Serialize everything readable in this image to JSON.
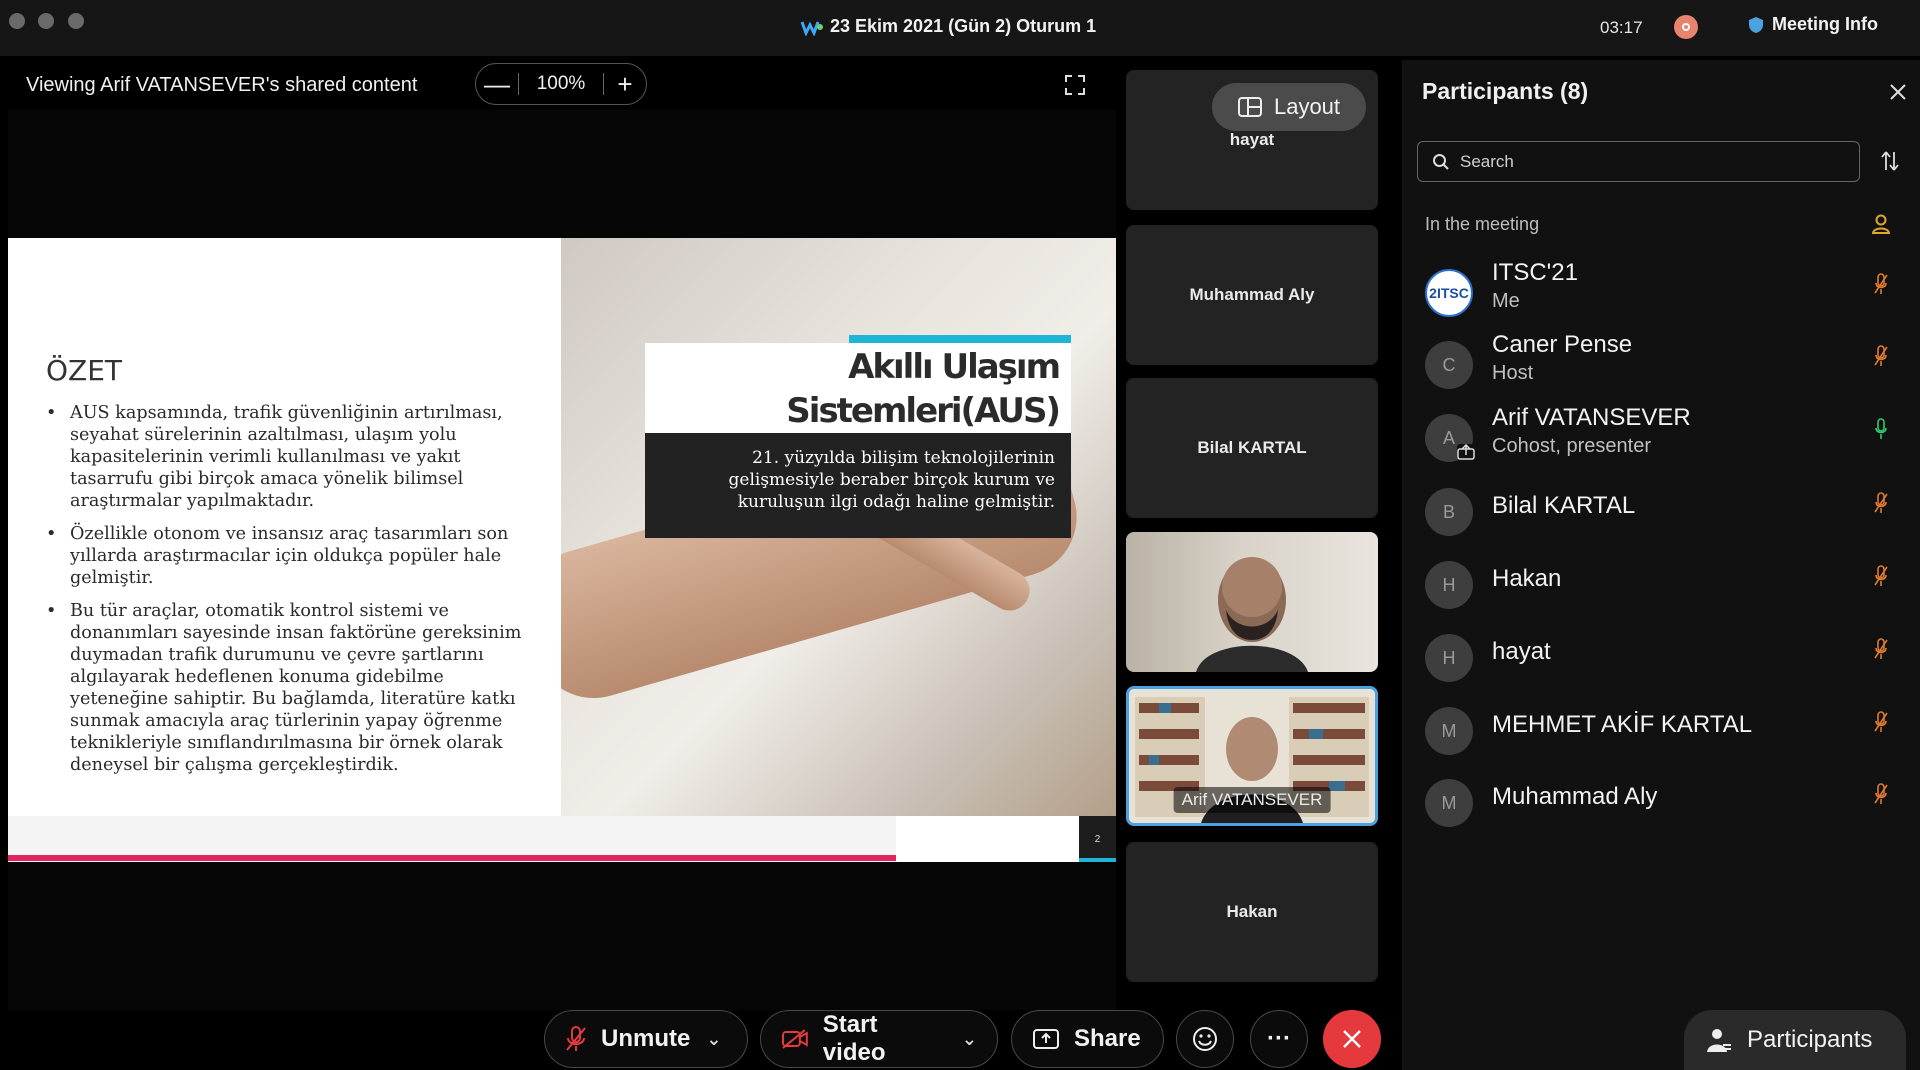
{
  "titlebar": {
    "title": "23 Ekim 2021 (Gün 2) Oturum 1",
    "clock": "03:17",
    "meeting_info_label": "Meeting Info"
  },
  "share": {
    "header": "Viewing Arif VATANSEVER's shared content",
    "zoom_level": "100%",
    "zoom_out_label": "—",
    "zoom_in_label": "+"
  },
  "slide": {
    "title": "ÖZET",
    "bullets": [
      "AUS kapsamında, trafik güvenliğinin artırılması, seyahat sürelerinin azaltılması, ulaşım yolu kapasitelerinin verimli kullanılması ve yakıt tasarrufu gibi birçok amaca yönelik bilimsel araştırmalar yapılmaktadır.",
      "Özellikle otonom ve insansız araç tasarımları son yıllarda araştırmacılar için oldukça popüler hale gelmiştir.",
      "Bu tür araçlar, otomatik kontrol sistemi ve donanımları sayesinde insan faktörüne gereksinim duymadan trafik durumunu ve çevre şartlarını algılayarak hedeflenen konuma gidebilme yeteneğine sahiptir. Bu bağlamda, literatüre katkı sunmak amacıyla araç türlerinin yapay öğrenme teknikleriyle sınıflandırılmasına bir örnek olarak deneysel bir çalışma gerçekleştirdik."
    ],
    "aus_title_line1": "Akıllı Ulaşım",
    "aus_title_line2": "Sistemleri(AUS)",
    "aus_subtitle": "21. yüzyılda bilişim teknolojilerinin gelişmesiyle beraber birçok kurum ve kuruluşun ilgi odağı haline gelmiştir.",
    "page_number": "2"
  },
  "video_strip": {
    "layout_label": "Layout",
    "tiles": [
      {
        "name": "hayat"
      },
      {
        "name": "Muhammad Aly"
      },
      {
        "name": "Bilal KARTAL"
      },
      {
        "name": ""
      },
      {
        "name": "Arif VATANSEVER"
      },
      {
        "name": "Hakan"
      }
    ]
  },
  "participants_panel": {
    "title": "Participants (8)",
    "search_placeholder": "Search",
    "section_label": "In the meeting",
    "participants": [
      {
        "initial": "2ITSC",
        "name": "ITSC'21",
        "role": "Me",
        "mic": "muted"
      },
      {
        "initial": "C",
        "name": "Caner Pense",
        "role": "Host",
        "mic": "muted"
      },
      {
        "initial": "A",
        "name": "Arif VATANSEVER",
        "role": "Cohost, presenter",
        "mic": "active"
      },
      {
        "initial": "B",
        "name": "Bilal KARTAL",
        "role": "",
        "mic": "muted"
      },
      {
        "initial": "H",
        "name": "Hakan",
        "role": "",
        "mic": "muted"
      },
      {
        "initial": "H",
        "name": "hayat",
        "role": "",
        "mic": "muted"
      },
      {
        "initial": "M",
        "name": "MEHMET AKİF KARTAL",
        "role": "",
        "mic": "muted"
      },
      {
        "initial": "M",
        "name": "Muhammad Aly",
        "role": "",
        "mic": "muted"
      }
    ]
  },
  "controls": {
    "unmute_label": "Unmute",
    "start_video_label": "Start video",
    "share_label": "Share",
    "more_label": "···",
    "participants_label": "Participants"
  },
  "colors": {
    "mic_muted": "#e07a2e",
    "mic_active": "#2ecc71",
    "end_button": "#e5393e",
    "selected_tile_border": "#4aa3e0",
    "slide_accent_pink": "#e0245e",
    "slide_accent_cyan": "#1fb5d6"
  }
}
